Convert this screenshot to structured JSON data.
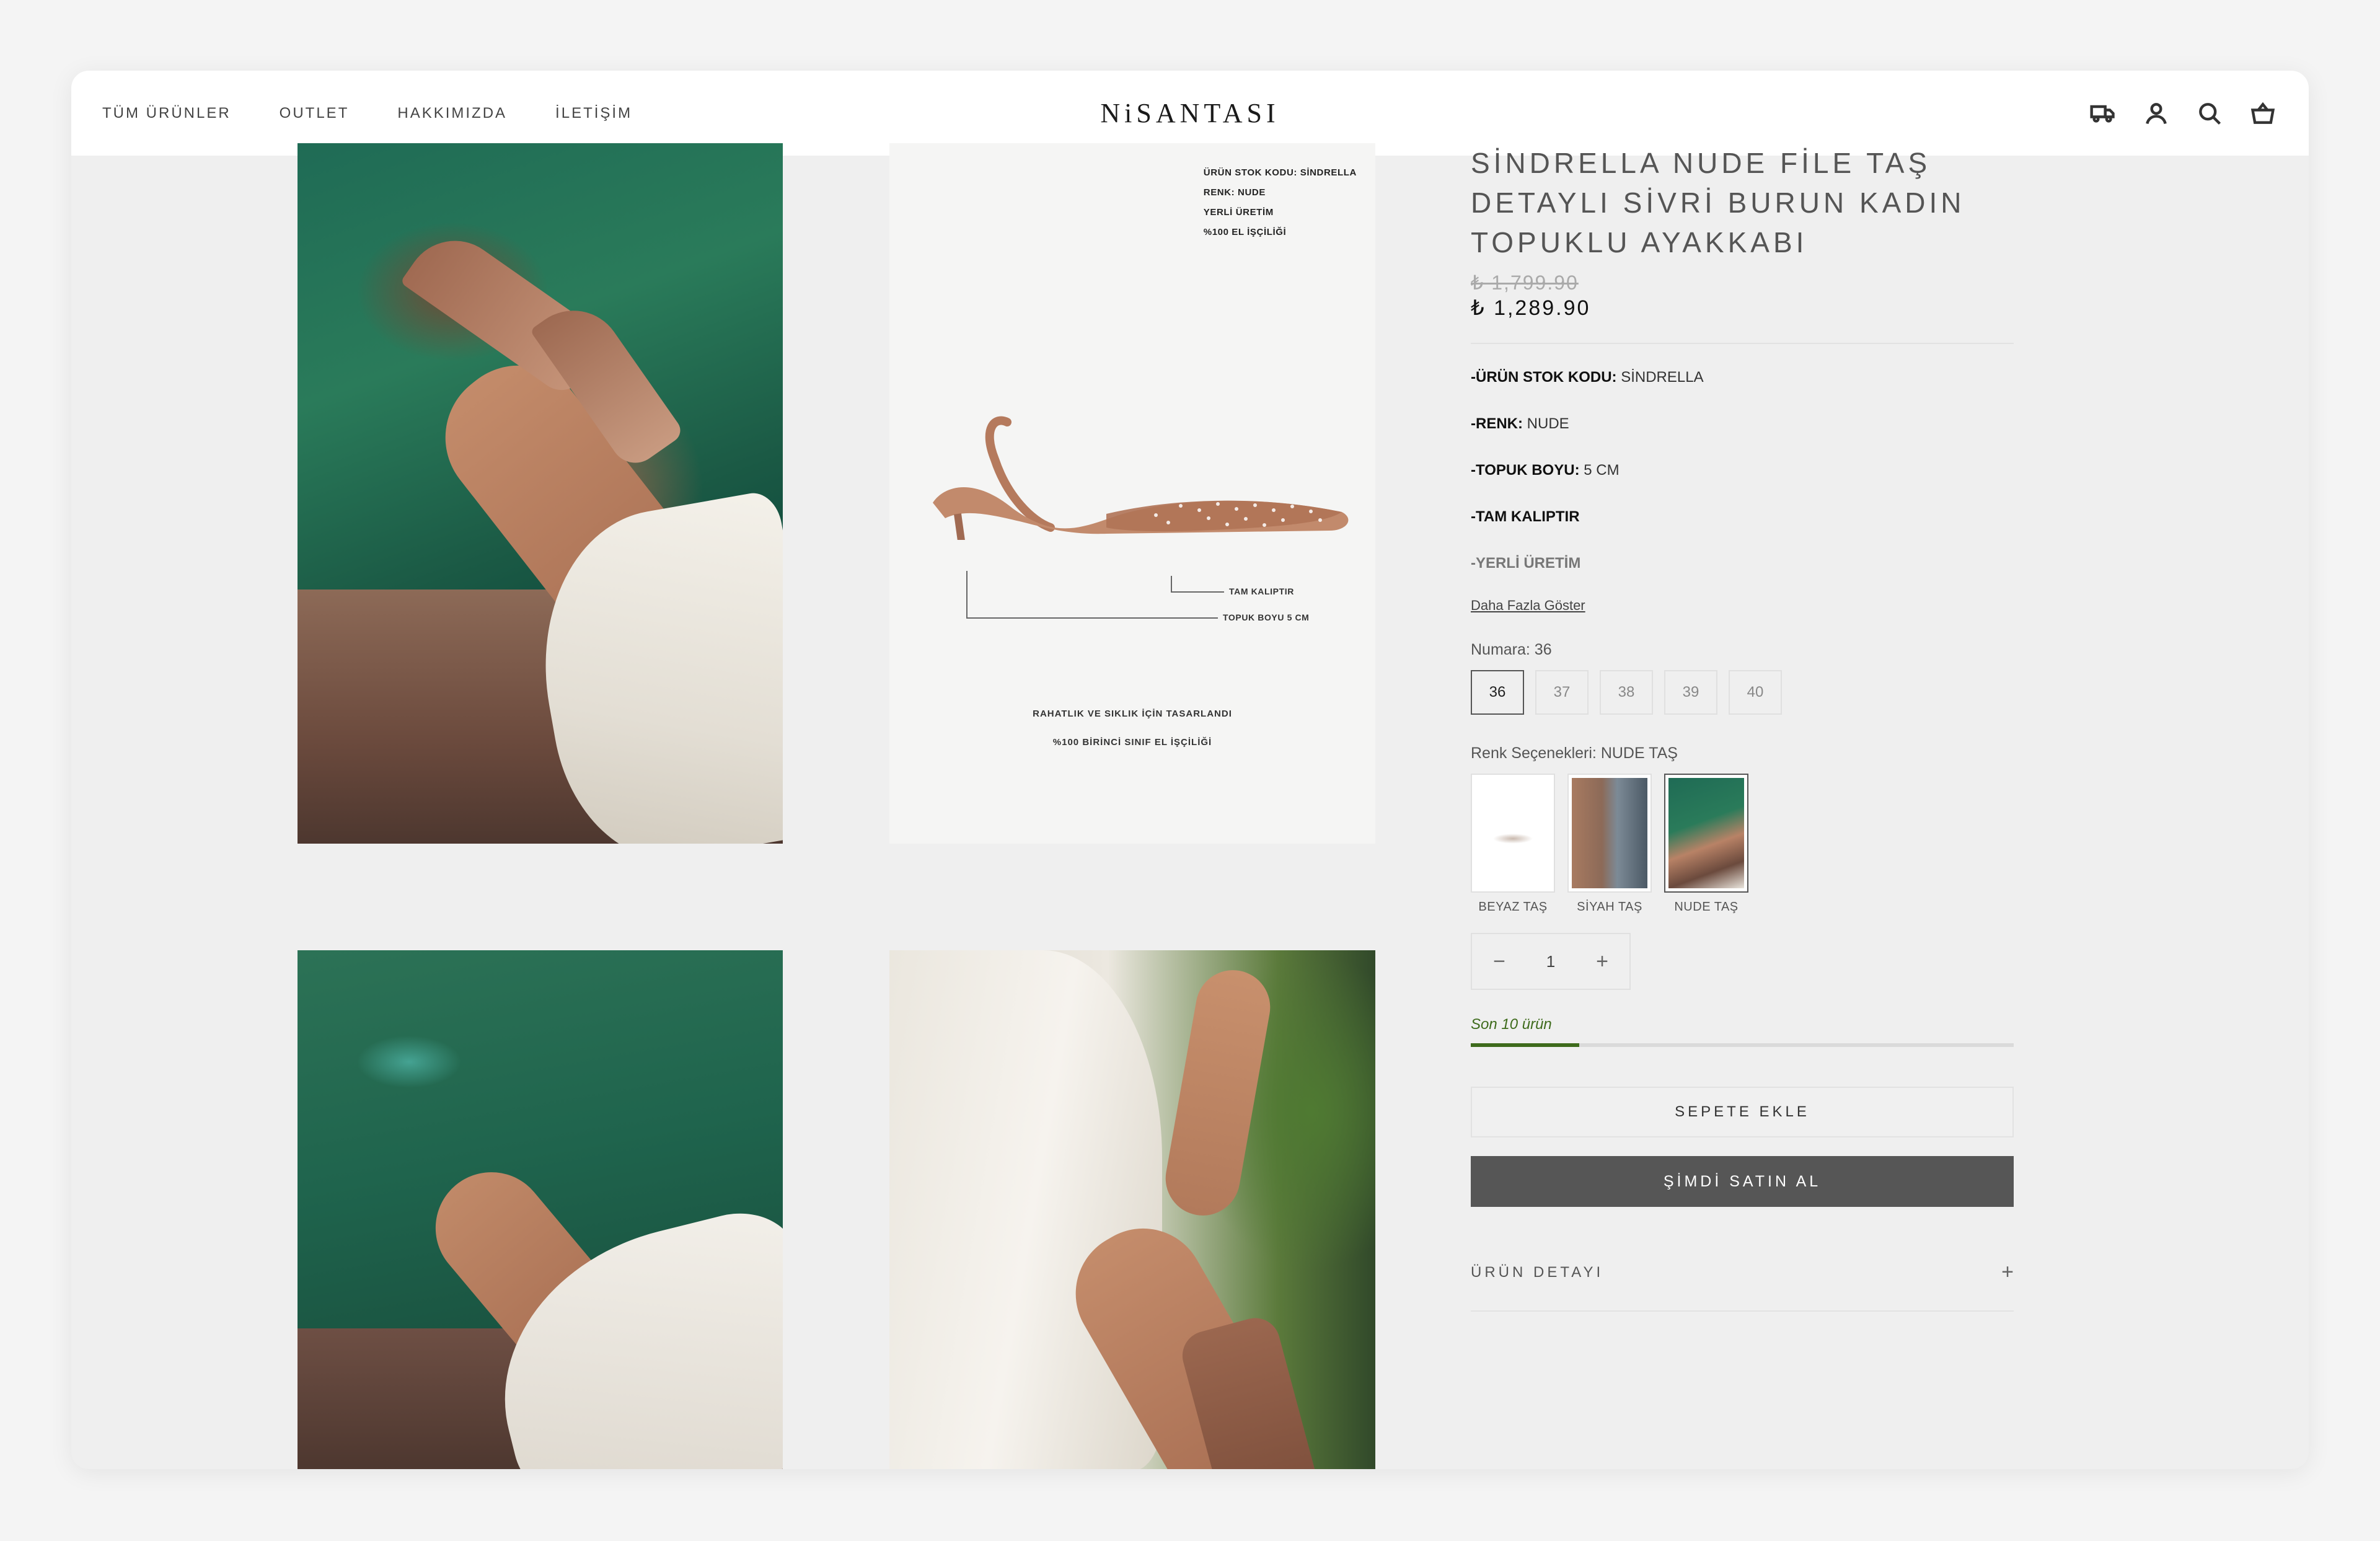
{
  "nav": {
    "links": [
      "TÜM ÜRÜNLER",
      "OUTLET",
      "HAKKIMIZDA",
      "İLETİŞİM"
    ],
    "logo": "NiSANTASI",
    "icons": [
      "delivery-truck-icon",
      "account-icon",
      "search-icon",
      "cart-basket-icon"
    ]
  },
  "gallery": {
    "spec_image": {
      "lines": [
        "ÜRÜN STOK KODU: SİNDRELLA",
        "RENK: NUDE",
        "YERLİ ÜRETİM",
        "%100 EL İŞÇİLİĞİ"
      ],
      "callout_fit": "TAM KALIPTIR",
      "callout_heel": "TOPUK BOYU 5 CM",
      "tagline_1": "RAHATLIK VE SIKLIK İÇİN TASARLANDI",
      "tagline_2": "%100 BİRİNCİ SINIF EL İŞÇİLİĞİ"
    }
  },
  "product": {
    "title_line1": "SİNDRELLA NUDE FİLE TAŞ",
    "title_line2": "DETAYLI SİVRİ BURUN KADIN",
    "title_line3": "TOPUKLU AYAKKABI",
    "old_price": "₺ 1,799.90",
    "new_price": "₺ 1,289.90",
    "specs": [
      {
        "label": "-ÜRÜN STOK KODU:",
        "value": " SİNDRELLA"
      },
      {
        "label": "-RENK:",
        "value": " NUDE"
      },
      {
        "label": "-TOPUK BOYU:",
        "value": " 5 CM"
      },
      {
        "label": "-TAM KALIPTIR",
        "value": ""
      },
      {
        "label": "",
        "value": "-YERLİ ÜRETİM"
      }
    ],
    "show_more": "Daha Fazla Göster",
    "size_label": "Numara: 36",
    "sizes": [
      "36",
      "37",
      "38",
      "39",
      "40"
    ],
    "selected_size": "36",
    "color_label": "Renk Seçenekleri: NUDE TAŞ",
    "colors": [
      "BEYAZ TAŞ",
      "SİYAH TAŞ",
      "NUDE TAŞ"
    ],
    "quantity": "1",
    "stock_text": "Son 10 ürün",
    "stock_level": 0.2,
    "add_to_cart": "SEPETE EKLE",
    "buy_now": "ŞİMDİ SATIN AL",
    "details_label": "ÜRÜN DETAYI",
    "details_toggle": "+"
  },
  "colors": {
    "accent_green": "#3e6b1c",
    "buy_button": "#565656"
  }
}
